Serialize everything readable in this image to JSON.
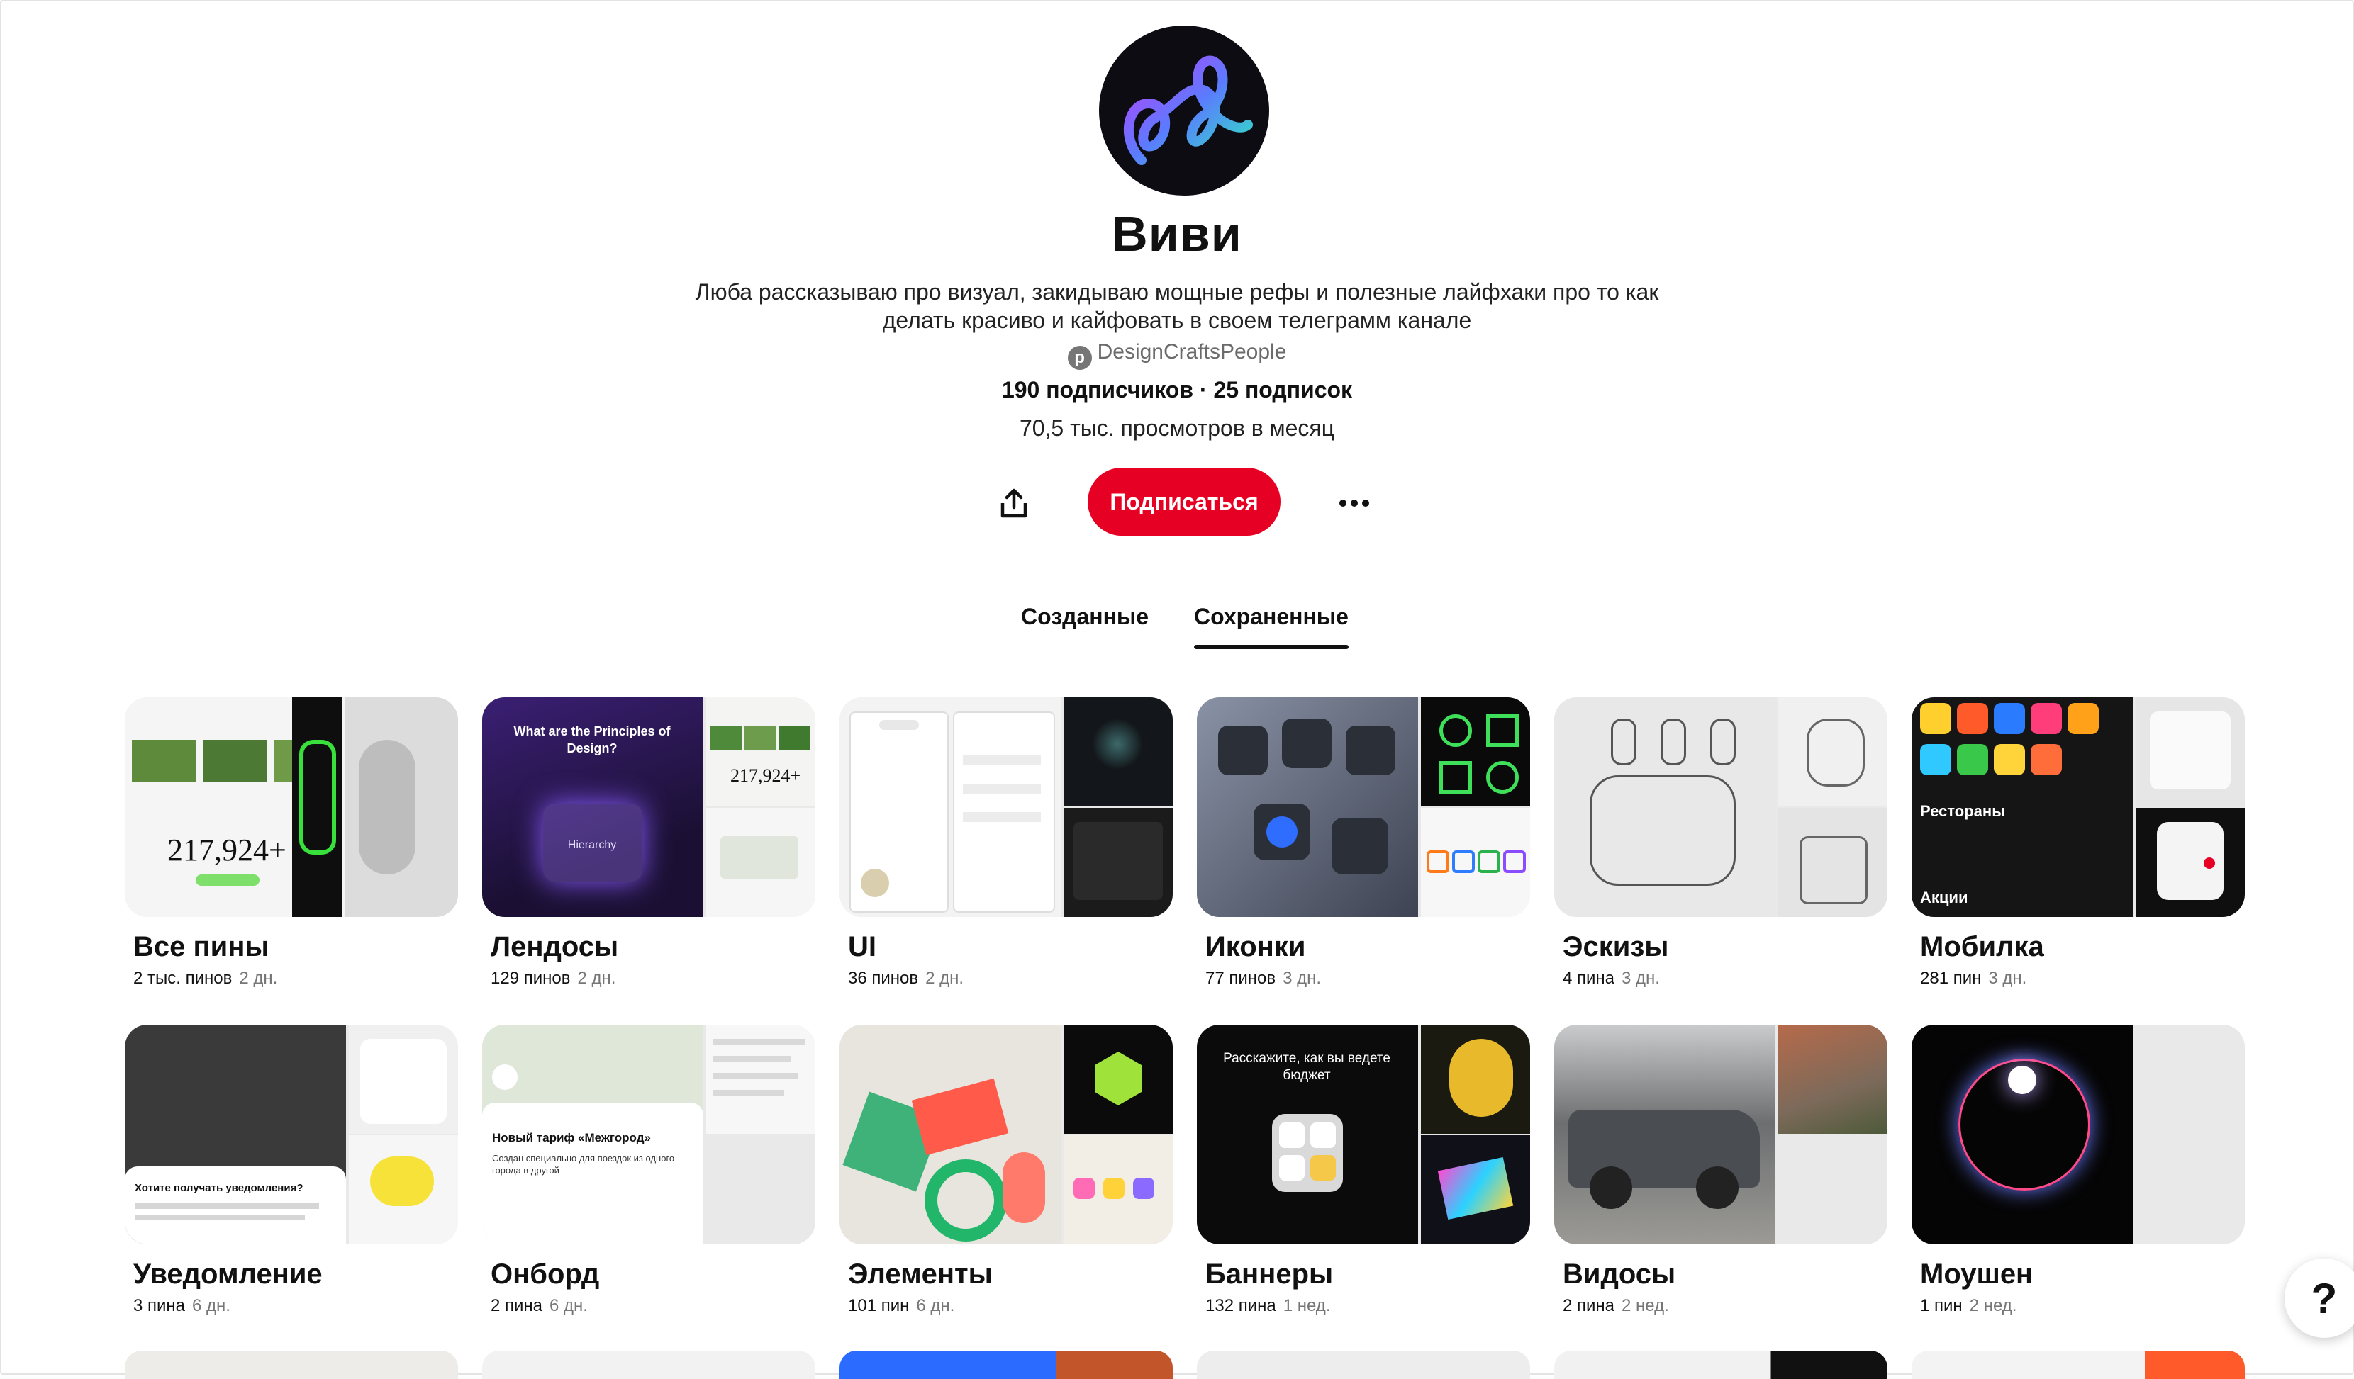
{
  "profile": {
    "name": "Виви",
    "bio": "Люба рассказываю про визуал, закидываю мощные рефы и полезные лайфхаки про то как делать красиво и кайфовать в своем телеграмм канале",
    "handle": "DesignCraftsPeople",
    "stats": "190 подписчиков · 25 подписок",
    "views": "70,5 тыс. просмотров в месяц"
  },
  "actions": {
    "follow_label": "Подписаться",
    "share_icon": "share-icon",
    "more_icon": "more-icon"
  },
  "tabs": [
    {
      "label": "Созданные",
      "active": false
    },
    {
      "label": "Сохраненные",
      "active": true
    }
  ],
  "boards": [
    {
      "title": "Все пины",
      "count": "2 тыс. пинов",
      "age": "2 дн.",
      "colors": [
        "#f4f4f4",
        "#111111",
        "#d9d9d9"
      ]
    },
    {
      "title": "Лендосы",
      "count": "129 пинов",
      "age": "2 дн.",
      "colors": [
        "#2a1a4a",
        "#f1f3f2",
        "#f5f5f5"
      ]
    },
    {
      "title": "UI",
      "count": "36 пинов",
      "age": "2 дн.",
      "colors": [
        "#f3f3f3",
        "#12161a",
        "#1b1b1b"
      ]
    },
    {
      "title": "Иконки",
      "count": "77 пинов",
      "age": "3 дн.",
      "colors": [
        "#5a6173",
        "#0a0a0a",
        "#f4f4f4"
      ]
    },
    {
      "title": "Эскизы",
      "count": "4 пина",
      "age": "3 дн.",
      "colors": [
        "#e6e6e6",
        "#efefef",
        "#dedede"
      ]
    },
    {
      "title": "Мобилка",
      "count": "281 пин",
      "age": "3 дн.",
      "colors": [
        "#151515",
        "#e6e6e6",
        "#0f0f0f"
      ]
    },
    {
      "title": "Уведомление",
      "count": "3 пина",
      "age": "6 дн.",
      "colors": [
        "#3a3a3a",
        "#f0f0f0",
        "#f6f6f6"
      ]
    },
    {
      "title": "Онборд",
      "count": "2 пина",
      "age": "6 дн.",
      "colors": [
        "#dfe7d9",
        "#f7f7f7",
        "#e9e9e9"
      ]
    },
    {
      "title": "Элементы",
      "count": "101 пин",
      "age": "6 дн.",
      "colors": [
        "#e8e5df",
        "#0b0b0b",
        "#f2eee6"
      ]
    },
    {
      "title": "Баннеры",
      "count": "132 пина",
      "age": "1 нед.",
      "colors": [
        "#0b0b0b",
        "#1a1a10",
        "#101018"
      ]
    },
    {
      "title": "Видосы",
      "count": "2 пина",
      "age": "2 нед.",
      "colors": [
        "#6c6e70",
        "#7d6a5a",
        "#e9e9e9"
      ]
    },
    {
      "title": "Моушен",
      "count": "1 пин",
      "age": "2 нед.",
      "colors": [
        "#050505",
        "#e9e9e9",
        "#e9e9e9"
      ]
    }
  ],
  "cover_texts": {
    "all_stat": "217,924+",
    "land_heading": "What are the Principles of Design?",
    "land_hierarchy": "Hierarchy",
    "mob_heading": "Рестораны",
    "mob_sub": "Акции",
    "notif_heading": "Хотите получать уведомления?",
    "onb_heading": "Новый тариф «Межгород»",
    "onb_sub": "Создан специально для поездок из одного города в другой",
    "ban_heading": "Расскажите, как вы ведете бюджет"
  },
  "help_label": "?"
}
